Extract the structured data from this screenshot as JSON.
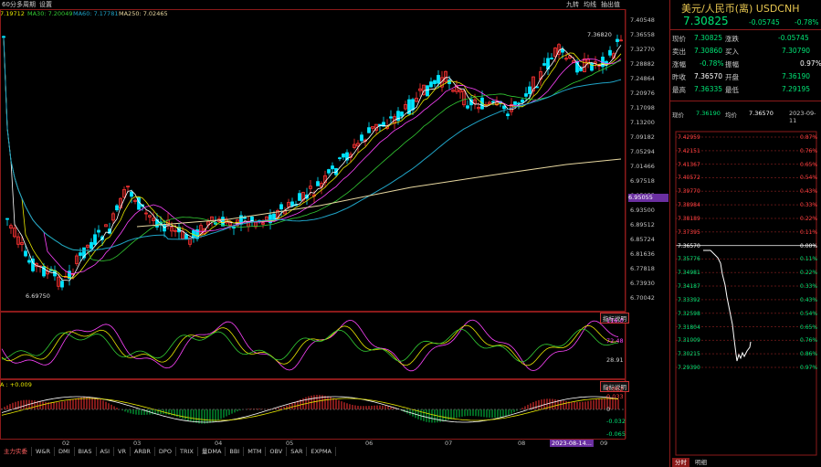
{
  "toolbar": {
    "period": "60分",
    "multi": "多周期",
    "settings": "设置",
    "right_buttons": [
      "九转",
      "均线",
      "抽出值"
    ]
  },
  "ma_legend": {
    "ma_prefix": "7.19712",
    "ma30": "MA30: 7.20049",
    "ma60": "MA60: 7.17781",
    "ma250": "MA250: 7.02465"
  },
  "price_axis": [
    "7.40548",
    "7.36558",
    "7.32770",
    "7.28882",
    "7.24864",
    "7.20976",
    "7.17098",
    "7.13200",
    "7.09182",
    "7.05294",
    "7.01466",
    "6.97518",
    "6.95055",
    "6.93500",
    "6.89512",
    "6.85724",
    "6.81636",
    "6.77818",
    "6.73930",
    "6.70042"
  ],
  "price_highlight": "6.95055",
  "annotations": {
    "high_label": "7.36820",
    "low_label": "6.69750"
  },
  "oscillator": {
    "label": "指标说明",
    "ticks": [
      "116.0",
      "72.48",
      "28.91"
    ]
  },
  "macd": {
    "prefix": "A : +0.009",
    "label": "指标说明",
    "ticks": [
      "0.052",
      "0.033",
      "0",
      "-0.032",
      "-0.065"
    ]
  },
  "months": [
    "02",
    "03",
    "04",
    "05",
    "06",
    "07",
    "08",
    "2023-08-14...",
    "09"
  ],
  "indicator_tabs": [
    "主力实委",
    "W&R",
    "DMI",
    "BIAS",
    "ASI",
    "VR",
    "ARBR",
    "DPO",
    "TRIX",
    "量DMA",
    "BBI",
    "MTM",
    "OBV",
    "SAR",
    "EXPMA"
  ],
  "quote": {
    "title": "美元/人民币(离) USDCNH",
    "price": "7.30825",
    "change": "-0.05745",
    "change_pct": "-0.78%",
    "rows": [
      {
        "l1": "现价",
        "v1": "7.30825",
        "l2": "涨跌",
        "v2": "-0.05745"
      },
      {
        "l1": "卖出",
        "v1": "7.30860",
        "l2": "买入",
        "v2": "7.30790"
      },
      {
        "l1": "涨幅",
        "v1": "-0.78%",
        "l2": "振幅",
        "v2": "0.97%"
      },
      {
        "l1": "昨收",
        "v1": "7.36570",
        "l2": "开盘",
        "v2": "7.36190"
      },
      {
        "l1": "最高",
        "v1": "7.36335",
        "l2": "最低",
        "v2": "7.29195"
      }
    ],
    "intraday_header": {
      "label": "现价",
      "price": "7.36190",
      "avg_label": "均价",
      "avg": "7.36570",
      "date": "2023-09-11"
    },
    "mini_left": [
      "7.42959",
      "7.42151",
      "7.41367",
      "7.40572",
      "7.39770",
      "7.38984",
      "7.38189",
      "7.37395",
      "7.36570",
      "7.35776",
      "7.34981",
      "7.34187",
      "7.33392",
      "7.32598",
      "7.31804",
      "7.31009",
      "7.30215",
      "7.29390"
    ],
    "mini_right": [
      "0.87%",
      "0.76%",
      "0.65%",
      "0.54%",
      "0.43%",
      "0.33%",
      "0.22%",
      "0.11%",
      "0.00%",
      "0.11%",
      "0.22%",
      "0.33%",
      "0.43%",
      "0.54%",
      "0.65%",
      "0.76%",
      "0.86%",
      "0.97%"
    ],
    "bottom_tabs": [
      "分时",
      "明细"
    ]
  },
  "colors": {
    "up": "#ff3333",
    "down": "#00e5ff",
    "bg": "#000000",
    "ma_yellow": "#e6e600",
    "ma_magenta": "#ff44ff",
    "ma_green": "#33cc33",
    "ma_cyan": "#1fa3c6",
    "ma250": "#e8d8a0"
  }
}
